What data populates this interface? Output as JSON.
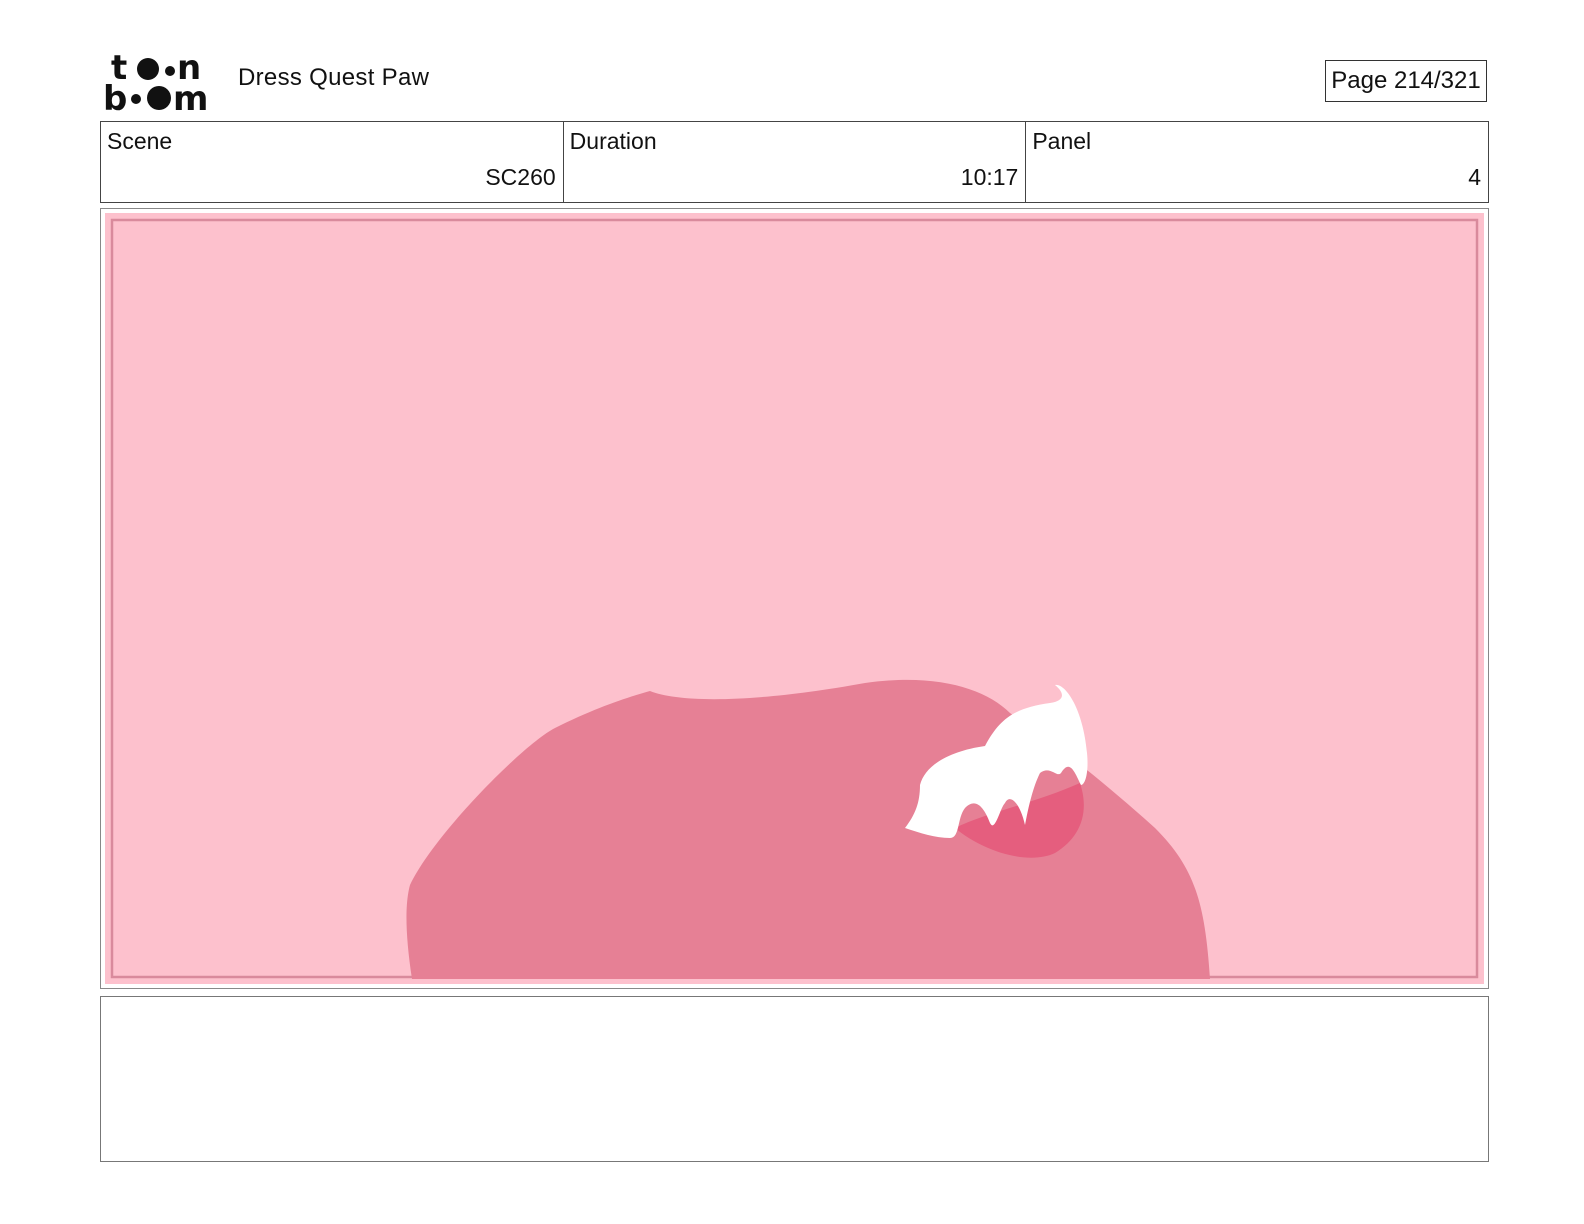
{
  "header": {
    "logo_text": "toonboom",
    "project_title": "Dress Quest Paw",
    "page_label": "Page 214/321"
  },
  "info": {
    "scene": {
      "label": "Scene",
      "value": "SC260"
    },
    "duration": {
      "label": "Duration",
      "value": "10:17"
    },
    "panel": {
      "label": "Panel",
      "value": "4"
    }
  },
  "panel_art": {
    "background_color": "#fdc1cd",
    "shape_color": "#e68095",
    "accent_color": "#e55e7e",
    "highlight_color": "#ffffff"
  },
  "notes": {
    "text": ""
  }
}
